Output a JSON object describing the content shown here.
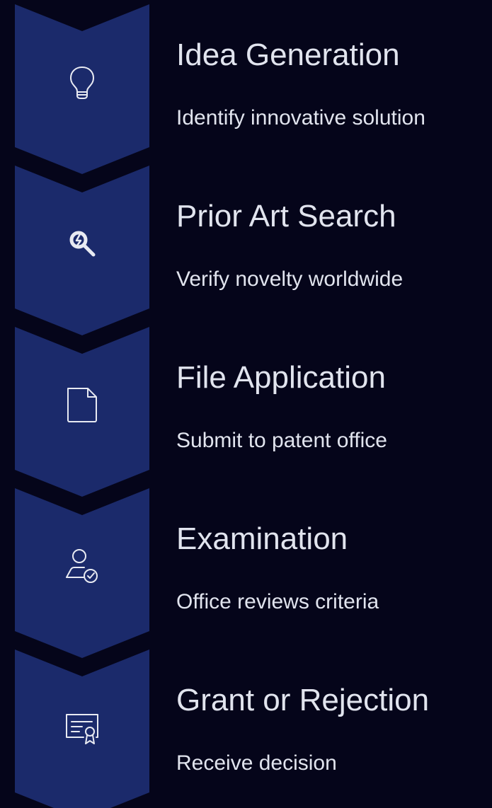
{
  "colors": {
    "background": "#05051a",
    "chevron_fill": "#1b2a6b",
    "chevron_edge": "#2a3a80",
    "icon_stroke": "#e8eaf2",
    "text": "#e1e4ee"
  },
  "steps": [
    {
      "title": "Idea Generation",
      "description": "Identify innovative solution",
      "icon": "lightbulb-icon"
    },
    {
      "title": "Prior Art Search",
      "description": "Verify novelty worldwide",
      "icon": "search-icon"
    },
    {
      "title": "File Application",
      "description": "Submit to patent office",
      "icon": "document-icon"
    },
    {
      "title": "Examination",
      "description": "Office reviews criteria",
      "icon": "user-check-icon"
    },
    {
      "title": "Grant or Rejection",
      "description": "Receive decision",
      "icon": "certificate-icon"
    }
  ]
}
